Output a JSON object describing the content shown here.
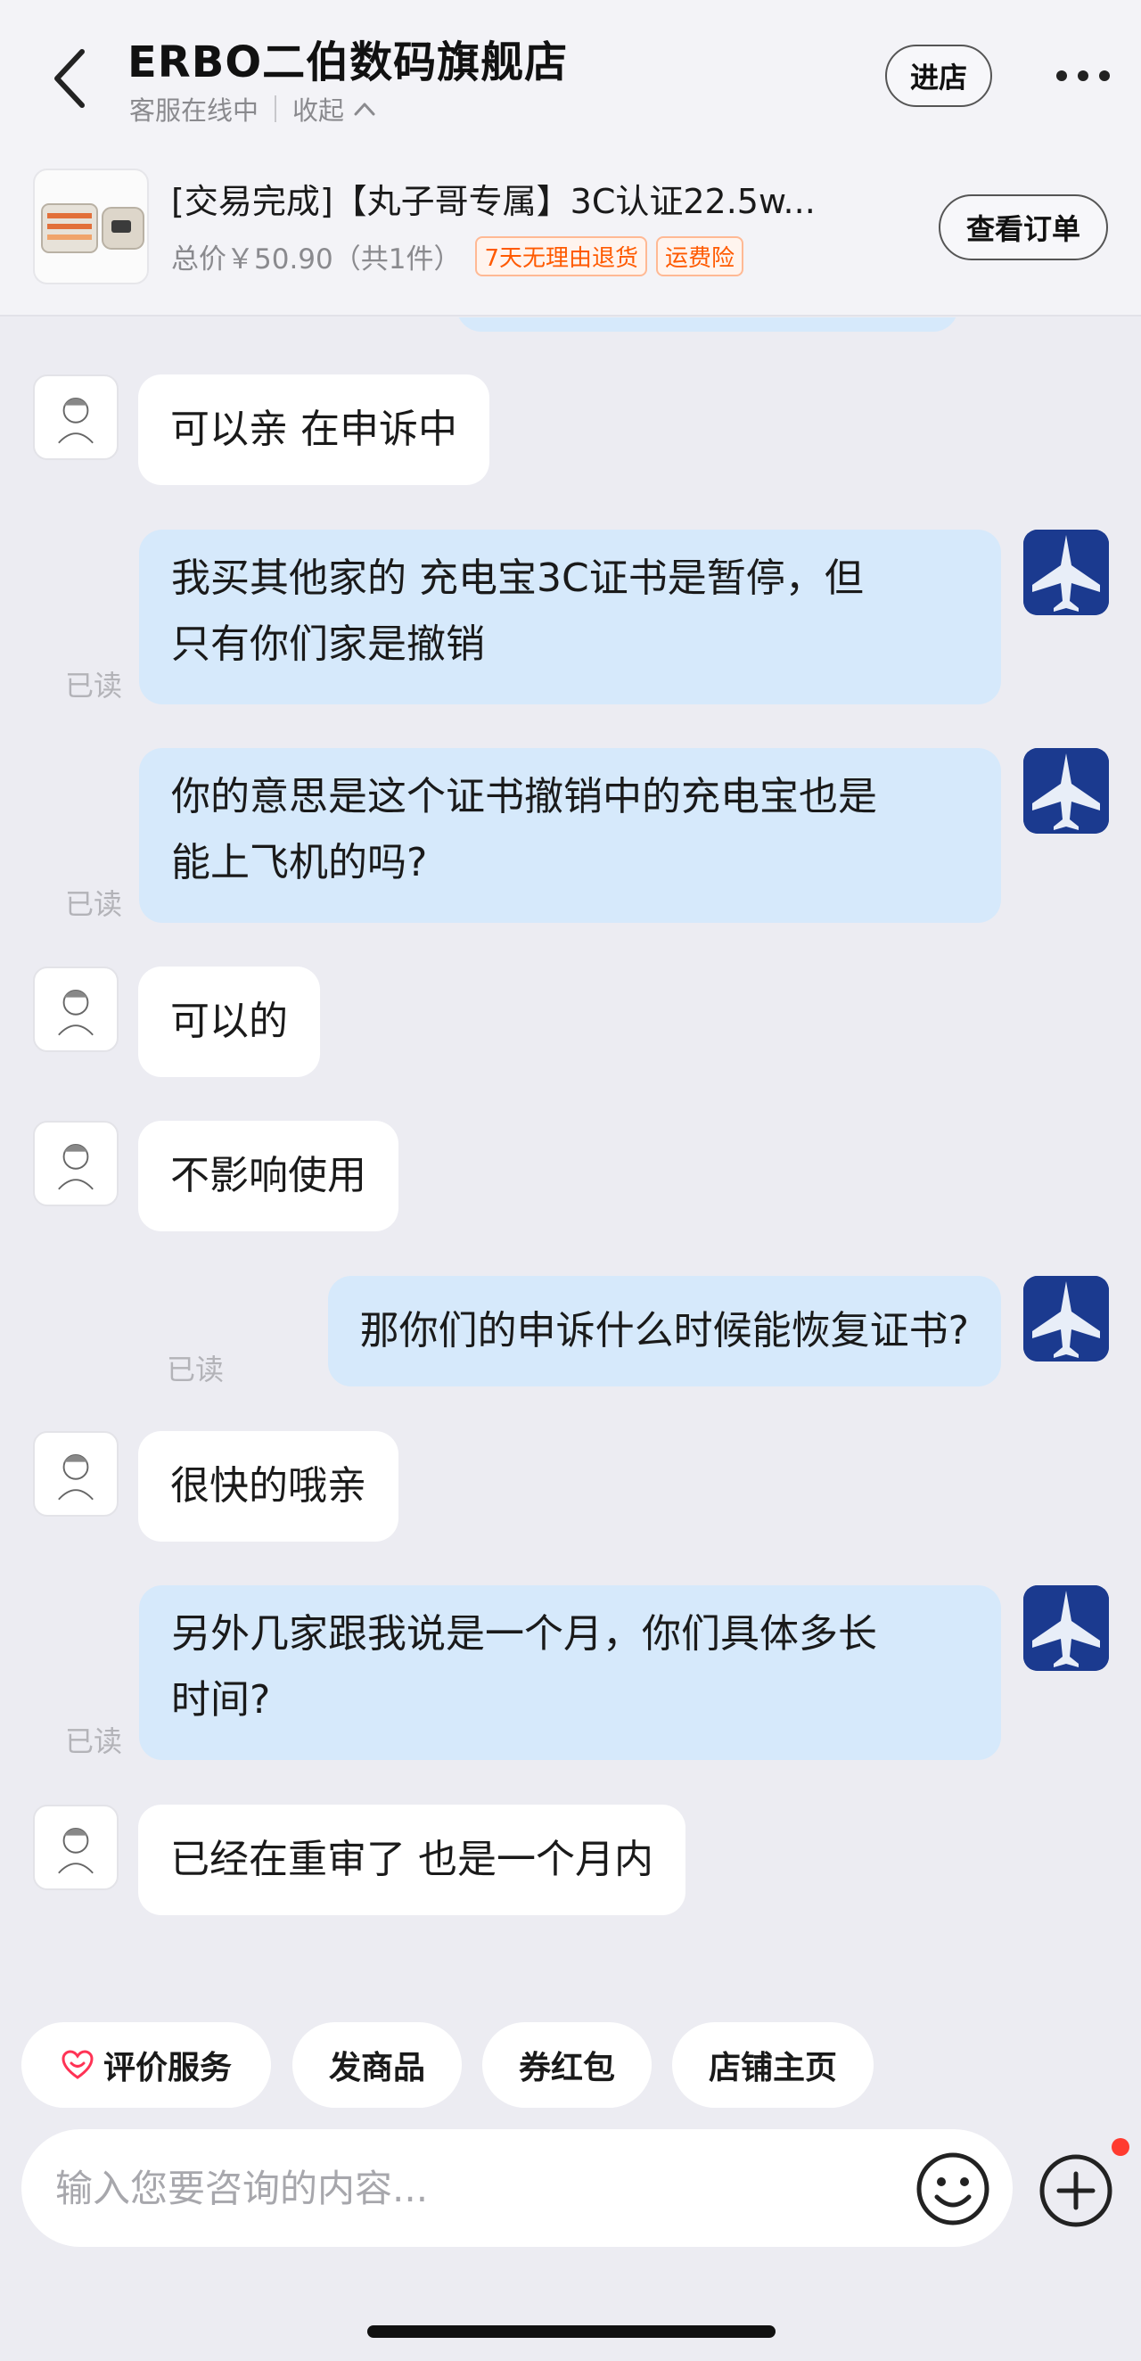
{
  "header": {
    "store_name": "ERBO二伯数码旗舰店",
    "status": "客服在线中",
    "collapse_label": "收起",
    "enter_store_label": "进店"
  },
  "order": {
    "title": "[交易完成]【丸子哥专属】3C认证22.5w...",
    "total_price": "总价￥50.90（共1件）",
    "tags": [
      "7天无理由退货",
      "运费险"
    ],
    "view_order_label": "查看订单"
  },
  "messages": [
    {
      "from": "seller",
      "text": "可以亲 在申诉中"
    },
    {
      "from": "me",
      "lines": [
        "我买其他家的  充电宝3C证书是暂停，但",
        "只有你们家是撤销"
      ],
      "read": "已读"
    },
    {
      "from": "me",
      "lines": [
        "你的意思是这个证书撤销中的充电宝也是",
        "能上飞机的吗?"
      ],
      "read": "已读"
    },
    {
      "from": "seller",
      "text": "可以的"
    },
    {
      "from": "seller",
      "text": "不影响使用"
    },
    {
      "from": "me",
      "text": "那你们的申诉什么时候能恢复证书?",
      "read": "已读"
    },
    {
      "from": "seller",
      "text": "很快的哦亲"
    },
    {
      "from": "me",
      "lines": [
        "另外几家跟我说是一个月，你们具体多长",
        "时间?"
      ],
      "read": "已读"
    },
    {
      "from": "seller",
      "text": "已经在重审了 也是一个月内"
    }
  ],
  "quick_actions": [
    "评价服务",
    "发商品",
    "券红包",
    "店铺主页"
  ],
  "input": {
    "placeholder": "输入您要咨询的内容..."
  },
  "colors": {
    "my_bubble": "#d6e9fb",
    "seller_bubble": "#ffffff",
    "background": "#ececf2",
    "tag_orange": "#ff5a00",
    "badge_red": "#ff3b30"
  },
  "icons": [
    "back-arrow-icon",
    "more-icon",
    "chevron-up-icon",
    "heart-rating-icon",
    "emoji-icon",
    "plus-icon"
  ]
}
